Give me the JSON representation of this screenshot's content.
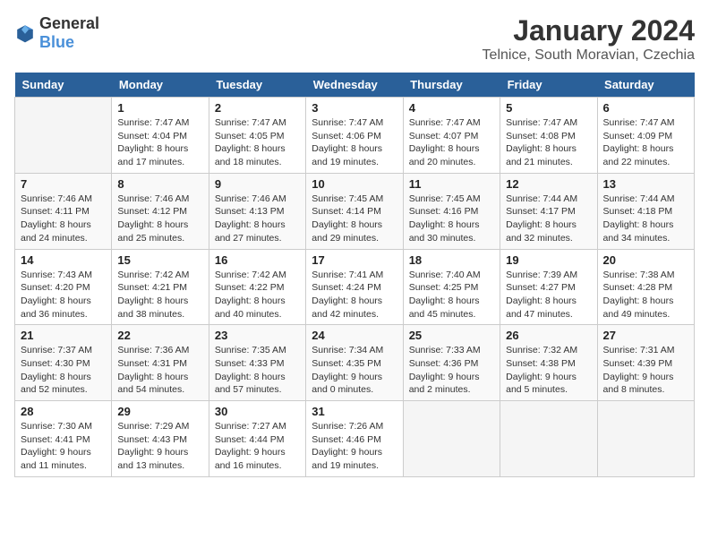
{
  "header": {
    "logo_general": "General",
    "logo_blue": "Blue",
    "month": "January 2024",
    "location": "Telnice, South Moravian, Czechia"
  },
  "weekdays": [
    "Sunday",
    "Monday",
    "Tuesday",
    "Wednesday",
    "Thursday",
    "Friday",
    "Saturday"
  ],
  "weeks": [
    [
      {
        "day": "",
        "sunrise": "",
        "sunset": "",
        "daylight": ""
      },
      {
        "day": "1",
        "sunrise": "7:47 AM",
        "sunset": "4:04 PM",
        "daylight": "8 hours and 17 minutes."
      },
      {
        "day": "2",
        "sunrise": "7:47 AM",
        "sunset": "4:05 PM",
        "daylight": "8 hours and 18 minutes."
      },
      {
        "day": "3",
        "sunrise": "7:47 AM",
        "sunset": "4:06 PM",
        "daylight": "8 hours and 19 minutes."
      },
      {
        "day": "4",
        "sunrise": "7:47 AM",
        "sunset": "4:07 PM",
        "daylight": "8 hours and 20 minutes."
      },
      {
        "day": "5",
        "sunrise": "7:47 AM",
        "sunset": "4:08 PM",
        "daylight": "8 hours and 21 minutes."
      },
      {
        "day": "6",
        "sunrise": "7:47 AM",
        "sunset": "4:09 PM",
        "daylight": "8 hours and 22 minutes."
      }
    ],
    [
      {
        "day": "7",
        "sunrise": "7:46 AM",
        "sunset": "4:11 PM",
        "daylight": "8 hours and 24 minutes."
      },
      {
        "day": "8",
        "sunrise": "7:46 AM",
        "sunset": "4:12 PM",
        "daylight": "8 hours and 25 minutes."
      },
      {
        "day": "9",
        "sunrise": "7:46 AM",
        "sunset": "4:13 PM",
        "daylight": "8 hours and 27 minutes."
      },
      {
        "day": "10",
        "sunrise": "7:45 AM",
        "sunset": "4:14 PM",
        "daylight": "8 hours and 29 minutes."
      },
      {
        "day": "11",
        "sunrise": "7:45 AM",
        "sunset": "4:16 PM",
        "daylight": "8 hours and 30 minutes."
      },
      {
        "day": "12",
        "sunrise": "7:44 AM",
        "sunset": "4:17 PM",
        "daylight": "8 hours and 32 minutes."
      },
      {
        "day": "13",
        "sunrise": "7:44 AM",
        "sunset": "4:18 PM",
        "daylight": "8 hours and 34 minutes."
      }
    ],
    [
      {
        "day": "14",
        "sunrise": "7:43 AM",
        "sunset": "4:20 PM",
        "daylight": "8 hours and 36 minutes."
      },
      {
        "day": "15",
        "sunrise": "7:42 AM",
        "sunset": "4:21 PM",
        "daylight": "8 hours and 38 minutes."
      },
      {
        "day": "16",
        "sunrise": "7:42 AM",
        "sunset": "4:22 PM",
        "daylight": "8 hours and 40 minutes."
      },
      {
        "day": "17",
        "sunrise": "7:41 AM",
        "sunset": "4:24 PM",
        "daylight": "8 hours and 42 minutes."
      },
      {
        "day": "18",
        "sunrise": "7:40 AM",
        "sunset": "4:25 PM",
        "daylight": "8 hours and 45 minutes."
      },
      {
        "day": "19",
        "sunrise": "7:39 AM",
        "sunset": "4:27 PM",
        "daylight": "8 hours and 47 minutes."
      },
      {
        "day": "20",
        "sunrise": "7:38 AM",
        "sunset": "4:28 PM",
        "daylight": "8 hours and 49 minutes."
      }
    ],
    [
      {
        "day": "21",
        "sunrise": "7:37 AM",
        "sunset": "4:30 PM",
        "daylight": "8 hours and 52 minutes."
      },
      {
        "day": "22",
        "sunrise": "7:36 AM",
        "sunset": "4:31 PM",
        "daylight": "8 hours and 54 minutes."
      },
      {
        "day": "23",
        "sunrise": "7:35 AM",
        "sunset": "4:33 PM",
        "daylight": "8 hours and 57 minutes."
      },
      {
        "day": "24",
        "sunrise": "7:34 AM",
        "sunset": "4:35 PM",
        "daylight": "9 hours and 0 minutes."
      },
      {
        "day": "25",
        "sunrise": "7:33 AM",
        "sunset": "4:36 PM",
        "daylight": "9 hours and 2 minutes."
      },
      {
        "day": "26",
        "sunrise": "7:32 AM",
        "sunset": "4:38 PM",
        "daylight": "9 hours and 5 minutes."
      },
      {
        "day": "27",
        "sunrise": "7:31 AM",
        "sunset": "4:39 PM",
        "daylight": "9 hours and 8 minutes."
      }
    ],
    [
      {
        "day": "28",
        "sunrise": "7:30 AM",
        "sunset": "4:41 PM",
        "daylight": "9 hours and 11 minutes."
      },
      {
        "day": "29",
        "sunrise": "7:29 AM",
        "sunset": "4:43 PM",
        "daylight": "9 hours and 13 minutes."
      },
      {
        "day": "30",
        "sunrise": "7:27 AM",
        "sunset": "4:44 PM",
        "daylight": "9 hours and 16 minutes."
      },
      {
        "day": "31",
        "sunrise": "7:26 AM",
        "sunset": "4:46 PM",
        "daylight": "9 hours and 19 minutes."
      },
      {
        "day": "",
        "sunrise": "",
        "sunset": "",
        "daylight": ""
      },
      {
        "day": "",
        "sunrise": "",
        "sunset": "",
        "daylight": ""
      },
      {
        "day": "",
        "sunrise": "",
        "sunset": "",
        "daylight": ""
      }
    ]
  ]
}
